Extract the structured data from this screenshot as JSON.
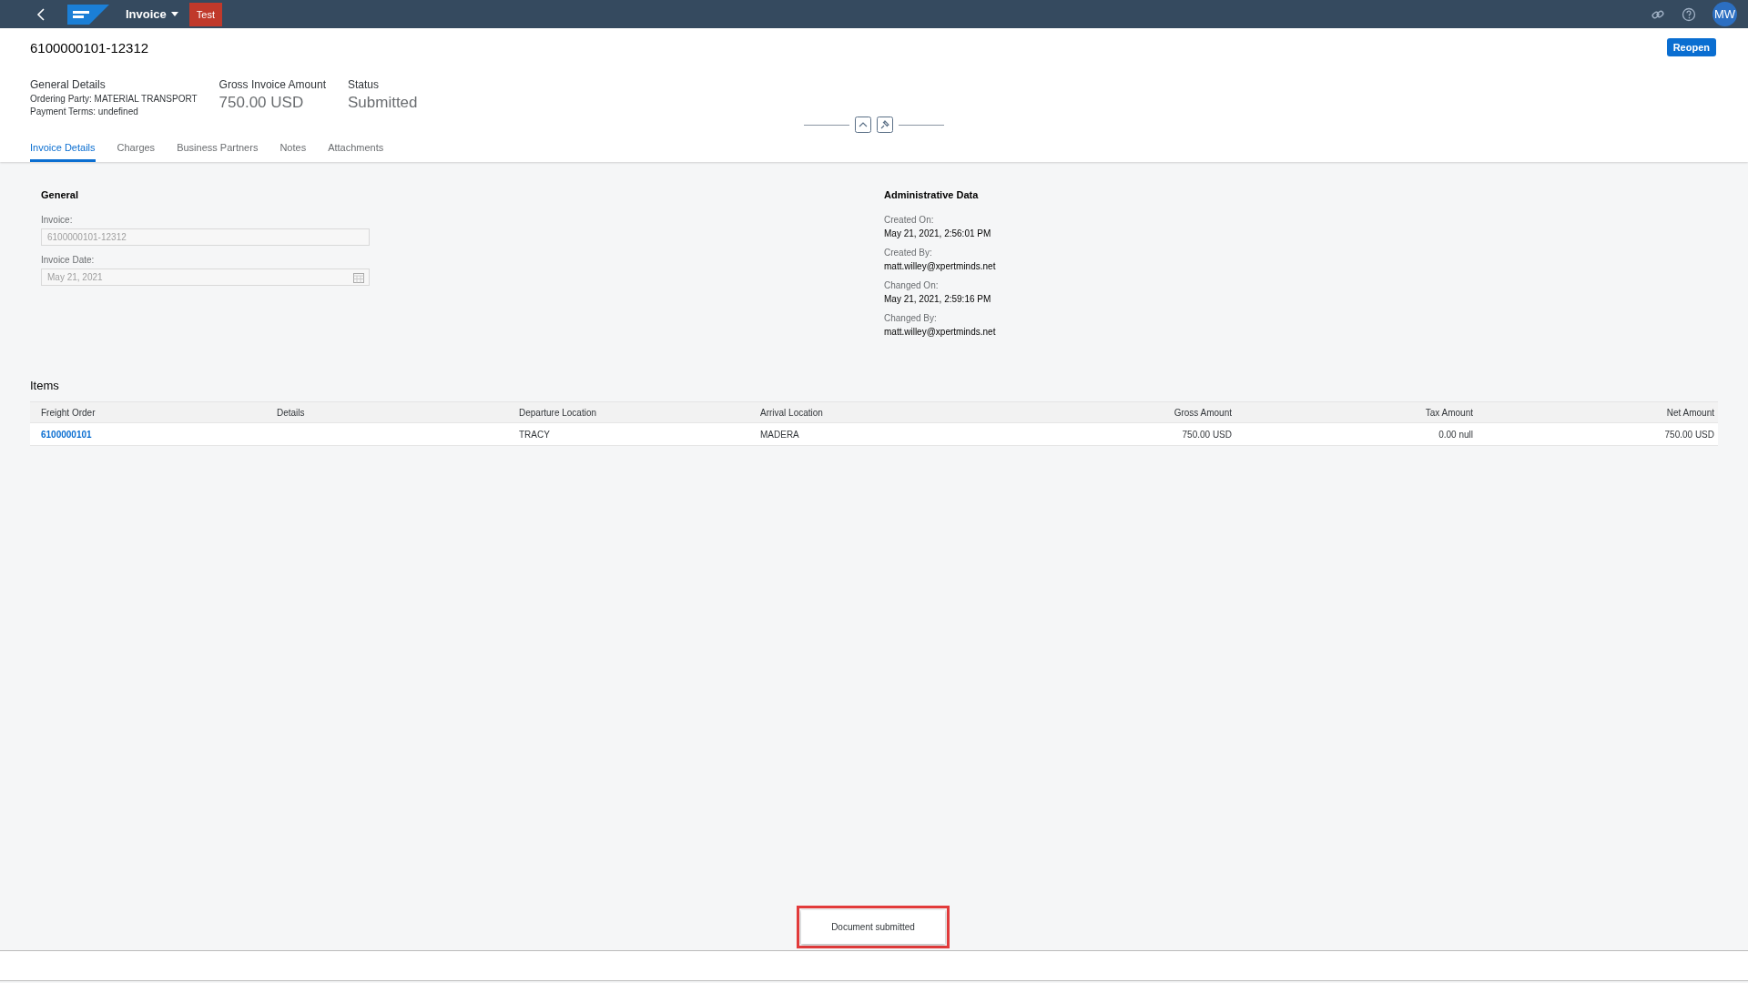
{
  "shell": {
    "app_title": "Invoice",
    "system_badge": "Test",
    "avatar_initials": "MW"
  },
  "header": {
    "title": "6100000101-12312",
    "action": "Reopen",
    "general": {
      "label": "General Details",
      "lines": [
        "Ordering Party: MATERIAL TRANSPORT",
        "Payment Terms: undefined"
      ]
    },
    "kpis": [
      {
        "label": "Gross Invoice Amount",
        "value": "750.00 USD"
      },
      {
        "label": "Status",
        "value": "Submitted"
      }
    ]
  },
  "tabs": [
    {
      "label": "Invoice Details",
      "selected": true
    },
    {
      "label": "Charges",
      "selected": false
    },
    {
      "label": "Business Partners",
      "selected": false
    },
    {
      "label": "Notes",
      "selected": false
    },
    {
      "label": "Attachments",
      "selected": false
    }
  ],
  "general": {
    "title": "General",
    "fields": [
      {
        "label": "Invoice:",
        "value": "6100000101-12312",
        "kind": "text"
      },
      {
        "label": "Invoice Date:",
        "value": "May 21, 2021",
        "kind": "date"
      }
    ]
  },
  "admin": {
    "title": "Administrative Data",
    "fields": [
      {
        "label": "Created On:",
        "value": "May 21, 2021, 2:56:01 PM"
      },
      {
        "label": "Created By:",
        "value": "matt.willey@xpertminds.net"
      },
      {
        "label": "Changed On:",
        "value": "May 21, 2021, 2:59:16 PM"
      },
      {
        "label": "Changed By:",
        "value": "matt.willey@xpertminds.net"
      }
    ]
  },
  "items": {
    "title": "Items",
    "columns": [
      "Freight Order",
      "Details",
      "Departure Location",
      "Arrival Location",
      "Gross Amount",
      "Tax Amount",
      "Net Amount"
    ],
    "rows": [
      [
        "6100000101",
        "",
        "TRACY",
        "MADERA",
        "750.00 USD",
        "0.00 null",
        "750.00 USD"
      ]
    ]
  },
  "toast": "Document submitted"
}
